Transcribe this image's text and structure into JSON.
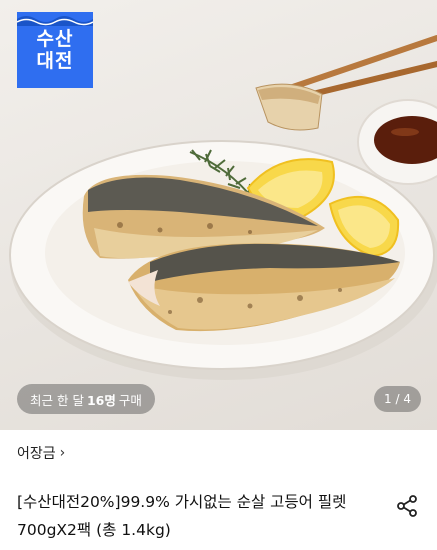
{
  "badge": {
    "line1": "수산",
    "line2": "대전"
  },
  "hero": {
    "purchase_prefix": "최근 한 달",
    "purchase_count": "16명",
    "purchase_suffix": "구매",
    "page_indicator": "1 / 4"
  },
  "product": {
    "brand": "어장금",
    "brand_chevron": "›",
    "title_line1": "[수산대전20%]99.9% 가시없는 순살 고등어 필렛",
    "title_line2": "700gX2팩 (총 1.4kg)"
  },
  "icons": {
    "share": "share-icon",
    "chevron": "chevron-right-icon"
  },
  "colors": {
    "badge_bg": "#2f6ef0",
    "overlay": "rgba(80,80,80,0.45)"
  }
}
